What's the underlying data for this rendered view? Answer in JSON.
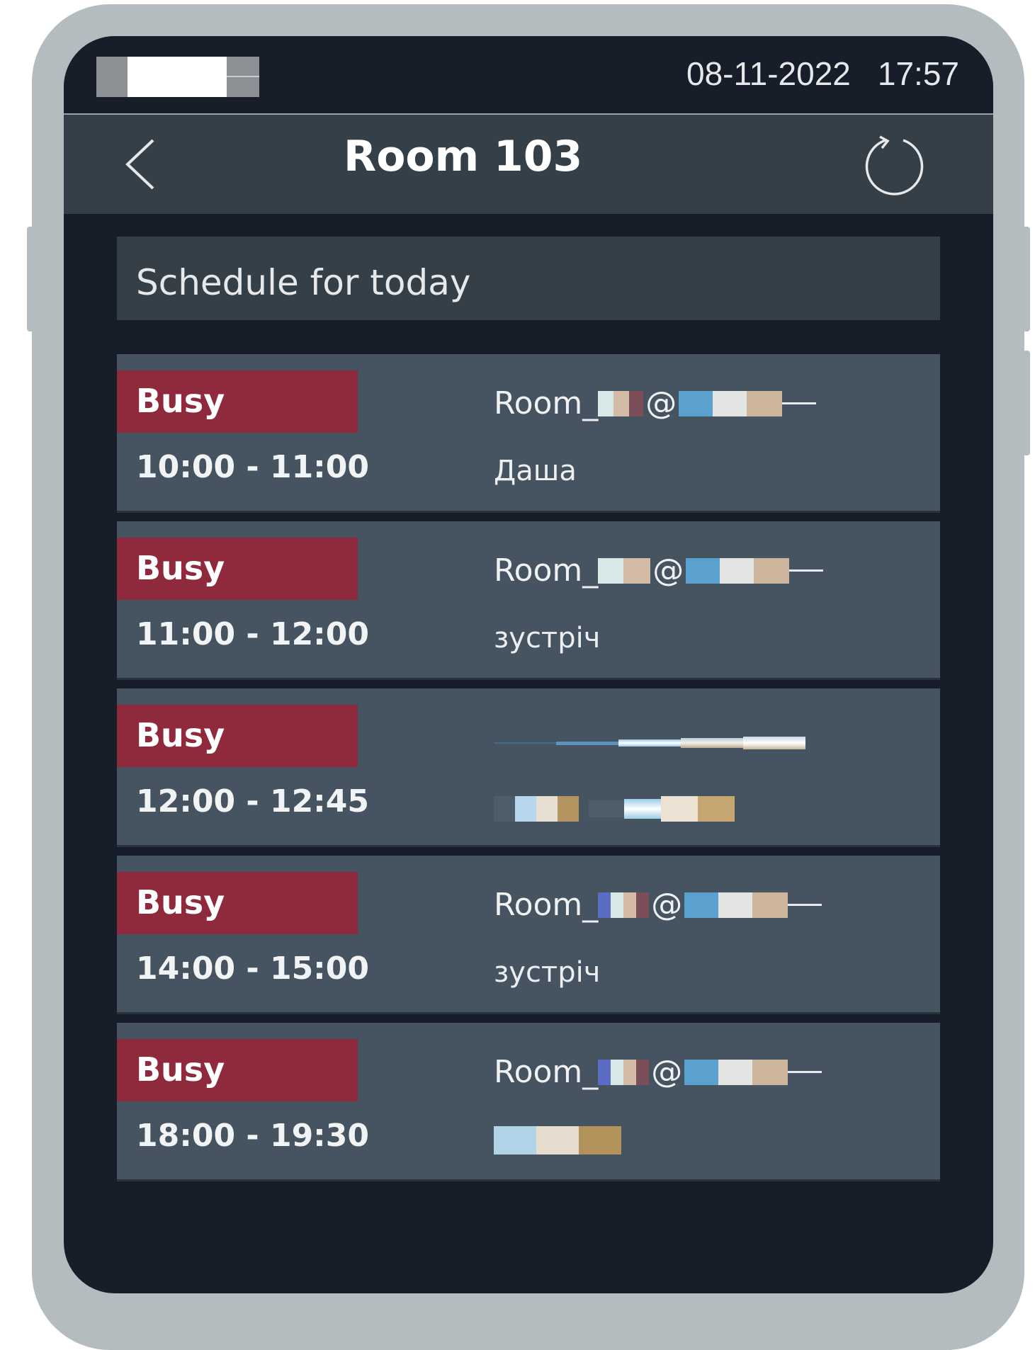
{
  "status_bar": {
    "date": "08-11-2022",
    "time": "17:57"
  },
  "nav": {
    "title": "Room 103"
  },
  "schedule": {
    "header": "Schedule for today",
    "events": [
      {
        "status": "Busy",
        "time": "10:00 - 11:00",
        "organizer_prefix": "Room_",
        "subject": "Даша"
      },
      {
        "status": "Busy",
        "time": "11:00 - 12:00",
        "organizer_prefix": "Room_",
        "subject": "зустріч"
      },
      {
        "status": "Busy",
        "time": "12:00 - 12:45",
        "organizer_prefix": "",
        "subject": ""
      },
      {
        "status": "Busy",
        "time": "14:00 - 15:00",
        "organizer_prefix": "Room_",
        "subject": "зустріч"
      },
      {
        "status": "Busy",
        "time": "18:00 - 19:30",
        "organizer_prefix": "Room_",
        "subject": ""
      }
    ]
  },
  "colors": {
    "busy_badge": "#8e2a3b",
    "event_row": "#455460",
    "screen_bg": "#171d29",
    "bar_bg": "#353f47"
  }
}
